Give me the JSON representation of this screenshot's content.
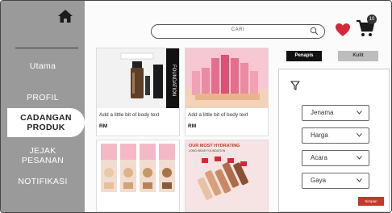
{
  "search": {
    "placeholder": "CARI"
  },
  "cart": {
    "count": "10"
  },
  "sidebar": {
    "items": [
      {
        "label": "Utama"
      },
      {
        "label": "PROFIL"
      },
      {
        "line1": "CADANGAN",
        "line2": "PRODUK",
        "active": true
      },
      {
        "line1": "JEJAK",
        "line2": "PESANAN"
      },
      {
        "label": "NOTIFIKASI"
      }
    ]
  },
  "products": [
    {
      "image_text": "FOUNDATION",
      "desc": "Add a little bit of body text",
      "price": "RM"
    },
    {
      "desc": "Add a little bit of body text",
      "price": "RM"
    },
    {},
    {
      "image_text_1": "OUR MOST HYDRATING",
      "image_text_2": "LONG WEAR FOUNDATION"
    }
  ],
  "filter": {
    "tab_penapis": "Penapis",
    "tab_kulit": "Kulit",
    "selects": [
      "Jenama",
      "Harga",
      "Acara",
      "Gaya"
    ],
    "apply": "Simpan"
  },
  "colors": {
    "sidebar": "#9a9a9a",
    "accent_red": "#c0392b",
    "heart": "#d62839"
  }
}
